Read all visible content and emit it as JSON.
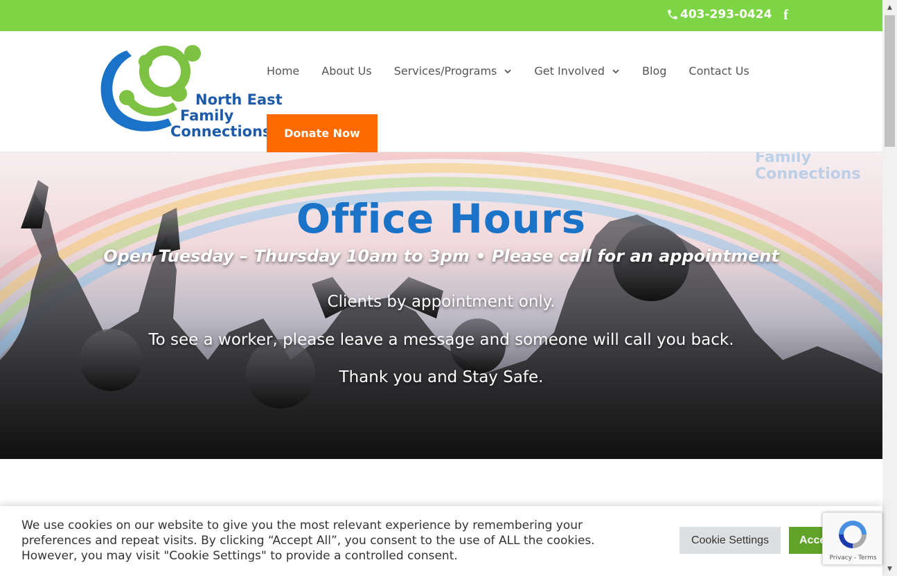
{
  "topbar": {
    "phone": "403-293-0424",
    "facebook": "f",
    "bg_color": "#7dd445"
  },
  "logo": {
    "line1": "North East",
    "line2": "Family",
    "line3": "Connections"
  },
  "nav": {
    "items": [
      {
        "label": "Home",
        "dropdown": false
      },
      {
        "label": "About Us",
        "dropdown": false
      },
      {
        "label": "Services/Programs",
        "dropdown": true
      },
      {
        "label": "Get Involved",
        "dropdown": true
      },
      {
        "label": "Blog",
        "dropdown": false
      },
      {
        "label": "Contact Us",
        "dropdown": false
      }
    ],
    "donate_label": "Donate Now",
    "donate_color": "#ff6a00"
  },
  "hero": {
    "title": "Office Hours",
    "subtitle": "Open Tuesday – Thursday 10am to 3pm • Please call for an appointment",
    "line1": "Clients by appointment only.",
    "line2": "To see a worker, please leave a message and someone will call you back.",
    "line3": "Thank you and Stay Safe.",
    "ghost_line1": "Family",
    "ghost_line2": "Connections",
    "title_color": "#1b73c8"
  },
  "cookie": {
    "text": "We use cookies on our website to give you the most relevant experience by remembering your preferences and repeat visits. By clicking “Accept All”, you consent to the use of ALL the cookies. However, you may visit \"Cookie Settings\" to provide a controlled consent.",
    "settings_label": "Cookie Settings",
    "accept_label": "Accept All",
    "accept_color": "#61a229"
  },
  "recaptcha": {
    "links": "Privacy - Terms"
  }
}
